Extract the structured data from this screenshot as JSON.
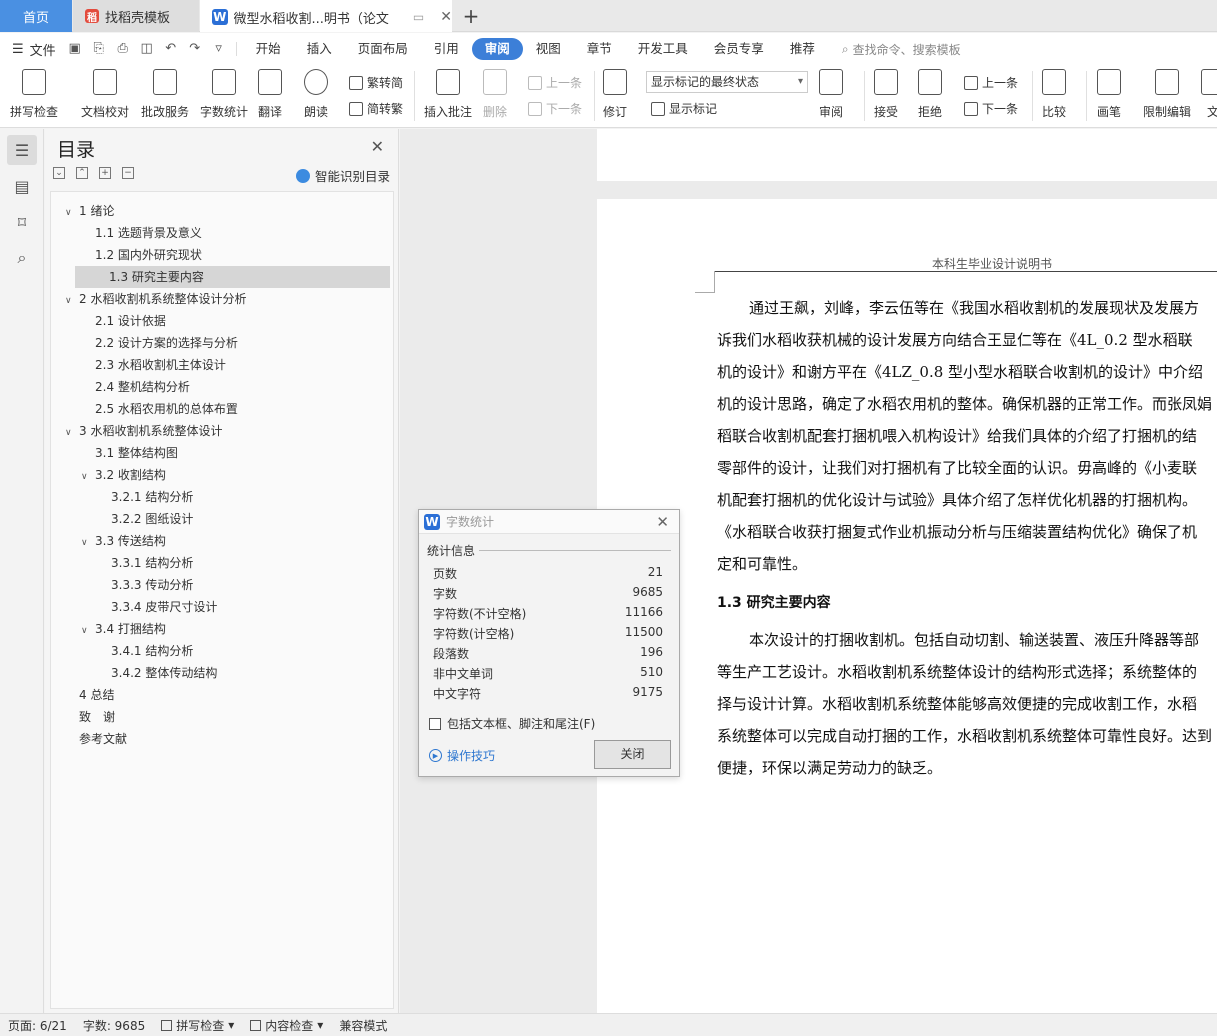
{
  "tabs": {
    "home": "首页",
    "template": "找稻壳模板",
    "doc": "微型水稻收割...明书（论文）",
    "add": "+"
  },
  "menu": {
    "file": "文件",
    "items": [
      "开始",
      "插入",
      "页面布局",
      "引用",
      "审阅",
      "视图",
      "章节",
      "开发工具",
      "会员专享",
      "推荐"
    ],
    "active": "审阅",
    "search": "查找命令、搜索模板"
  },
  "ribbon": {
    "spell_check": "拼写检查",
    "doc_proof": "文档校对",
    "revise_service": "批改服务",
    "word_count": "字数统计",
    "translate": "翻译",
    "read_aloud": "朗读",
    "trad_to_simp": "繁转简",
    "simp_to_trad": "简转繁",
    "insert_comment": "插入批注",
    "delete": "删除",
    "prev": "上一条",
    "next": "下一条",
    "track": "修订",
    "markup_state": "显示标记的最终状态",
    "show_markup": "显示标记",
    "review": "审阅",
    "accept": "接受",
    "reject": "拒绝",
    "prev2": "上一条",
    "next2": "下一条",
    "compare": "比较",
    "pen": "画笔",
    "restrict_edit": "限制编辑",
    "doc_perm": "文"
  },
  "toc": {
    "title": "目录",
    "smart": "智能识别目录",
    "items": [
      {
        "label": "1 绪论",
        "level": 1,
        "expanded": true
      },
      {
        "label": "1.1 选题背景及意义",
        "level": 2
      },
      {
        "label": "1.2 国内外研究现状",
        "level": 2
      },
      {
        "label": "1.3 研究主要内容",
        "level": 2,
        "selected": true
      },
      {
        "label": "2 水稻收割机系统整体设计分析",
        "level": 1,
        "expanded": true
      },
      {
        "label": "2.1 设计依据",
        "level": 2
      },
      {
        "label": "2.2  设计方案的选择与分析",
        "level": 2
      },
      {
        "label": "2.3 水稻收割机主体设计",
        "level": 2
      },
      {
        "label": "2.4 整机结构分析",
        "level": 2
      },
      {
        "label": "2.5 水稻农用机的总体布置",
        "level": 2
      },
      {
        "label": "3 水稻收割机系统整体设计",
        "level": 1,
        "expanded": true
      },
      {
        "label": "3.1 整体结构图",
        "level": 2
      },
      {
        "label": "3.2 收割结构",
        "level": 2,
        "expanded": true
      },
      {
        "label": "3.2.1 结构分析",
        "level": 3
      },
      {
        "label": "3.2.2 图纸设计",
        "level": 3
      },
      {
        "label": "3.3 传送结构",
        "level": 2,
        "expanded": true
      },
      {
        "label": "3.3.1 结构分析",
        "level": 3
      },
      {
        "label": "3.3.3 传动分析",
        "level": 3
      },
      {
        "label": "3.3.4 皮带尺寸设计",
        "level": 3
      },
      {
        "label": "3.4 打捆结构",
        "level": 2,
        "expanded": true
      },
      {
        "label": "3.4.1 结构分析",
        "level": 3
      },
      {
        "label": "3.4.2 整体传动结构",
        "level": 3
      },
      {
        "label": "4 总结",
        "level": 1
      },
      {
        "label": "致　谢",
        "level": 1
      },
      {
        "label": "参考文献",
        "level": 1
      }
    ]
  },
  "doc": {
    "header": "本科生毕业设计说明书",
    "para1": [
      "通过王飙，刘峰，李云伍等在《我国水稻收割机的发展现状及发展方",
      "诉我们水稻收获机械的设计发展方向结合王显仁等在《4L_0.2 型水稻联",
      "机的设计》和谢方平在《4LZ_0.8 型小型水稻联合收割机的设计》中介绍",
      "机的设计思路，确定了水稻农用机的整体。确保机器的正常工作。而张凤娟",
      "稻联合收割机配套打捆机喂入机构设计》给我们具体的介绍了打捆机的结",
      "零部件的设计，让我们对打捆机有了比较全面的认识。毋高峰的《小麦联",
      "机配套打捆机的优化设计与试验》具体介绍了怎样优化机器的打捆机构。",
      "《水稻联合收获打捆复式作业机振动分析与压缩装置结构优化》确保了机",
      "定和可靠性。"
    ],
    "heading": "1.3 研究主要内容",
    "para2": [
      "本次设计的打捆收割机。包括自动切割、输送装置、液压升降器等部",
      "等生产工艺设计。水稻收割机系统整体设计的结构形式选择；系统整体的",
      "择与设计计算。水稻收割机系统整体能够高效便捷的完成收割工作，水稻",
      "系统整体可以完成自动打捆的工作，水稻收割机系统整体可靠性良好。达到",
      "便捷，环保以满足劳动力的缺乏。"
    ]
  },
  "dialog": {
    "title": "字数统计",
    "group": "统计信息",
    "stats": [
      {
        "label": "页数",
        "value": "21"
      },
      {
        "label": "字数",
        "value": "9685"
      },
      {
        "label": "字符数(不计空格)",
        "value": "11166"
      },
      {
        "label": "字符数(计空格)",
        "value": "11500"
      },
      {
        "label": "段落数",
        "value": "196"
      },
      {
        "label": "非中文单词",
        "value": "510"
      },
      {
        "label": "中文字符",
        "value": "9175"
      }
    ],
    "checkbox": "包括文本框、脚注和尾注(F)",
    "tips": "操作技巧",
    "close": "关闭"
  },
  "status": {
    "page": "页面: 6/21",
    "words": "字数: 9685",
    "spell": "拼写检查",
    "content": "内容检查",
    "compat": "兼容模式"
  }
}
